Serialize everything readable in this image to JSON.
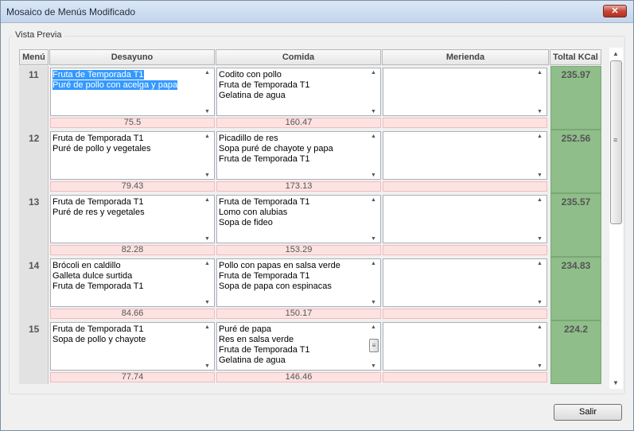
{
  "window": {
    "title": "Mosaico de Menús Modificado",
    "close_label": "✕"
  },
  "group": {
    "label": "Vista Previa"
  },
  "columns": {
    "menu": "Menú",
    "desayuno": "Desayuno",
    "comida": "Comida",
    "merienda": "Merienda",
    "total": "Toltal KCal"
  },
  "rows": [
    {
      "menu": "11",
      "desayuno": [
        "Fruta de Temporada T1",
        "Puré de pollo con acelga y papa"
      ],
      "desayuno_kcal": "75.5",
      "comida": [
        "Codito con pollo",
        "Fruta de Temporada T1",
        "Gelatina de agua"
      ],
      "comida_kcal": "160.47",
      "merienda": [],
      "merienda_kcal": "",
      "total": "235.97"
    },
    {
      "menu": "12",
      "desayuno": [
        "Fruta de Temporada T1",
        "Puré de pollo y vegetales"
      ],
      "desayuno_kcal": "79.43",
      "comida": [
        "Picadillo de res",
        "Sopa puré de chayote y papa",
        "Fruta de Temporada T1"
      ],
      "comida_kcal": "173.13",
      "merienda": [],
      "merienda_kcal": "",
      "total": "252.56"
    },
    {
      "menu": "13",
      "desayuno": [
        "Fruta de Temporada T1",
        "Puré de res y vegetales"
      ],
      "desayuno_kcal": "82.28",
      "comida": [
        "Fruta de Temporada T1",
        "Lomo con alubias",
        "Sopa de fideo"
      ],
      "comida_kcal": "153.29",
      "merienda": [],
      "merienda_kcal": "",
      "total": "235.57"
    },
    {
      "menu": "14",
      "desayuno": [
        "Brócoli en caldillo",
        "Galleta dulce surtida",
        "Fruta de Temporada T1"
      ],
      "desayuno_kcal": "84.66",
      "comida": [
        "Pollo con papas en salsa verde",
        "Fruta de Temporada T1",
        "Sopa de papa con espinacas"
      ],
      "comida_kcal": "150.17",
      "merienda": [],
      "merienda_kcal": "",
      "total": "234.83"
    },
    {
      "menu": "15",
      "desayuno": [
        "Fruta de Temporada T1",
        "Sopa de pollo y chayote"
      ],
      "desayuno_kcal": "77.74",
      "comida": [
        "Puré de papa",
        "Res en salsa verde",
        "Fruta de Temporada T1",
        "Gelatina de agua"
      ],
      "comida_kcal": "146.46",
      "merienda": [],
      "merienda_kcal": "",
      "total": "224.2"
    }
  ],
  "buttons": {
    "salir": "Salir"
  }
}
